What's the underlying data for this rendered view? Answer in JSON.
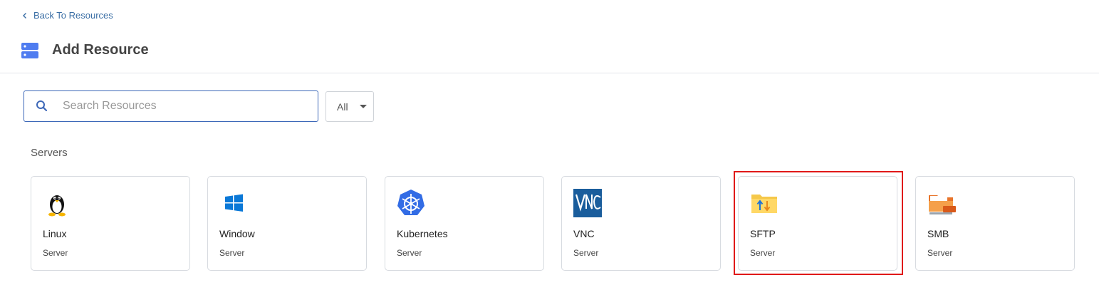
{
  "back_link": {
    "label": "Back To Resources",
    "icon": "chevron-left-icon"
  },
  "header": {
    "title": "Add Resource",
    "icon": "server-stack-icon"
  },
  "search": {
    "placeholder": "Search Resources",
    "value": "",
    "icon": "search-icon"
  },
  "filter": {
    "selected": "All",
    "icon": "caret-down-icon"
  },
  "section": {
    "title": "Servers"
  },
  "cards": [
    {
      "name": "Linux",
      "type": "Server",
      "icon": "linux-tux-icon"
    },
    {
      "name": "Window",
      "type": "Server",
      "icon": "windows-logo-icon"
    },
    {
      "name": "Kubernetes",
      "type": "Server",
      "icon": "kubernetes-logo-icon"
    },
    {
      "name": "VNC",
      "type": "Server",
      "icon": "vnc-logo-icon"
    },
    {
      "name": "SFTP",
      "type": "Server",
      "icon": "sftp-folder-icon"
    },
    {
      "name": "SMB",
      "type": "Server",
      "icon": "smb-folder-icon"
    }
  ],
  "colors": {
    "accent": "#3d68b8",
    "link": "#3a6ea5",
    "highlight": "#e01919",
    "header_icon": "#4f7cf0"
  }
}
